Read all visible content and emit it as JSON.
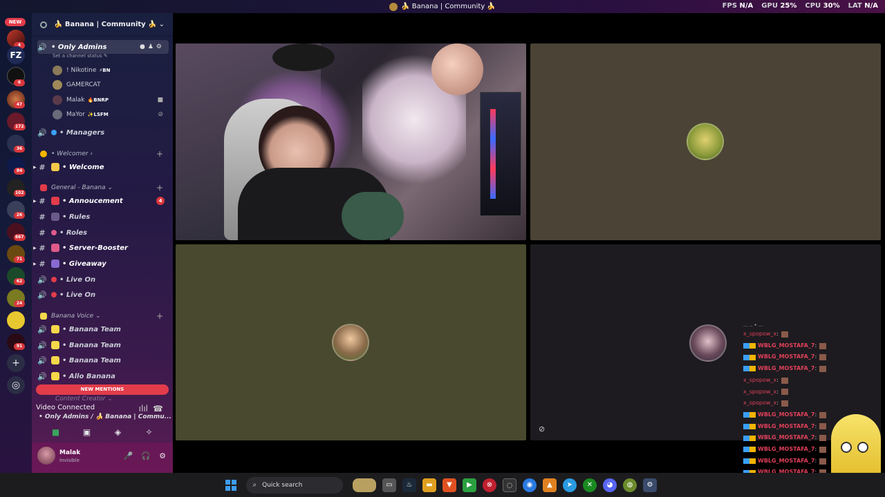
{
  "window": {
    "title": "🍌 Banana | Community 🍌",
    "stats": [
      {
        "label": "FPS",
        "value": "N/A"
      },
      {
        "label": "GPU",
        "value": "25%"
      },
      {
        "label": "CPU",
        "value": "30%"
      },
      {
        "label": "LAT",
        "value": "N/A"
      }
    ]
  },
  "rail": {
    "new_label": "NEW",
    "badges": [
      "4",
      "6",
      "47",
      "172",
      "36",
      "84",
      "102",
      "26",
      "667",
      "71",
      "62",
      "24",
      "91"
    ]
  },
  "server": {
    "name": "🍌 Banana | Community 🍌"
  },
  "channels": {
    "only_admins": "• Only Admins",
    "status_hint": "Set a channel status ✎",
    "members": [
      {
        "name": "! Nikotine",
        "tag": "⚡BN"
      },
      {
        "name": "GAMERCAT",
        "tag": ""
      },
      {
        "name": "Malak",
        "tag": "🔥BNRP"
      },
      {
        "name": "MaYor",
        "tag": "✨LSFM"
      }
    ],
    "managers": "• Managers",
    "cat_welcomer": "• Welcomer ›",
    "welcome": "• Welcome",
    "cat_general": "General - Banana ⌄",
    "annoucement": "• Annoucement",
    "annoucement_count": "4",
    "rules": "• Rules",
    "roles": "• Roles",
    "server_booster": "• Server-Booster",
    "giveaway": "• Giveaway",
    "live_on_1": "• Live On",
    "live_on_2": "• Live On",
    "cat_voice": "Banana Voice ⌄",
    "banana_team_1": "• Banana Team",
    "banana_team_2": "• Banana Team",
    "banana_team_3": "• Banana Team",
    "allo_banana": "• Allo Banana",
    "cat_content": "Content Creator ⌄",
    "new_mentions": "NEW MENTIONS"
  },
  "voice": {
    "title": "Video Connected",
    "subtitle": "• Only Admins / 🍌 Banana | Commu..."
  },
  "user": {
    "name": "Malak",
    "status": "Invisible"
  },
  "chat": {
    "top": "... .. • ...",
    "lines": [
      {
        "user": "x_spopow_x",
        "style": "plain"
      },
      {
        "user": "WBLG_MOSTAFA_7",
        "style": "badge"
      },
      {
        "user": "WBLG_MOSTAFA_7",
        "style": "badge"
      },
      {
        "user": "WBLG_MOSTAFA_7",
        "style": "badge"
      },
      {
        "user": "x_spopow_x",
        "style": "plain"
      },
      {
        "user": "x_spopow_x",
        "style": "plain"
      },
      {
        "user": "x_spopow_x",
        "style": "plain"
      },
      {
        "user": "WBLG_MOSTAFA_7",
        "style": "badge"
      },
      {
        "user": "WBLG_MOSTAFA_7",
        "style": "badge"
      },
      {
        "user": "WBLG_MOSTAFA_7",
        "style": "badge"
      },
      {
        "user": "WBLG_MOSTAFA_7",
        "style": "badge"
      },
      {
        "user": "WBLG_MOSTAFA_7",
        "style": "badge"
      },
      {
        "user": "WBLG_MOSTAFA_7",
        "style": "badge"
      },
      {
        "user": "WBLG_MOSTAFA_7",
        "style": "badge"
      }
    ]
  },
  "taskbar": {
    "search_label": "Quick search"
  }
}
